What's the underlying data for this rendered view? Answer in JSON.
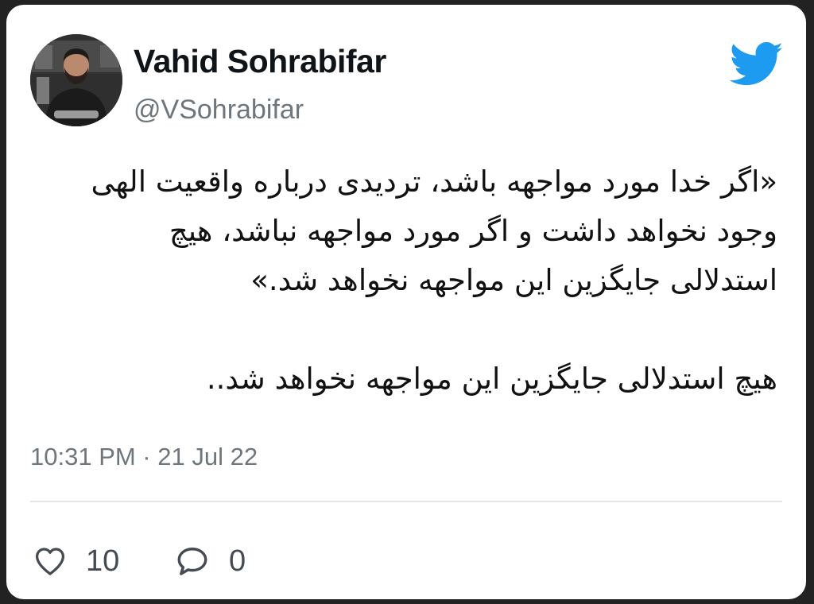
{
  "author": {
    "name": "Vahid Sohrabifar",
    "handle": "@VSohrabifar"
  },
  "tweet": {
    "paragraph_1": [
      "«اگر خدا مورد مواجهه باشد، تردیدی درباره واقعیت الهی",
      "وجود نخواهد داشت و اگر مورد مواجهه نباشد، هیچ",
      "استدلالی جایگزین این مواجهه نخواهد شد.»"
    ],
    "paragraph_2": [
      "هیچ استدلالی جایگزین این مواجهه نخواهد شد.."
    ]
  },
  "meta": {
    "timestamp": "10:31 PM · 21 Jul 22"
  },
  "actions": {
    "likes": "10",
    "replies": "0"
  },
  "icons": {
    "brand": "twitter-bird-icon",
    "like": "heart-icon",
    "reply": "speech-bubble-icon"
  },
  "colors": {
    "twitter_blue": "#1d9bf0",
    "name_text": "#0f1419",
    "secondary_text": "#6e767d",
    "card_background": "#ffffff",
    "page_background": "#222222"
  }
}
